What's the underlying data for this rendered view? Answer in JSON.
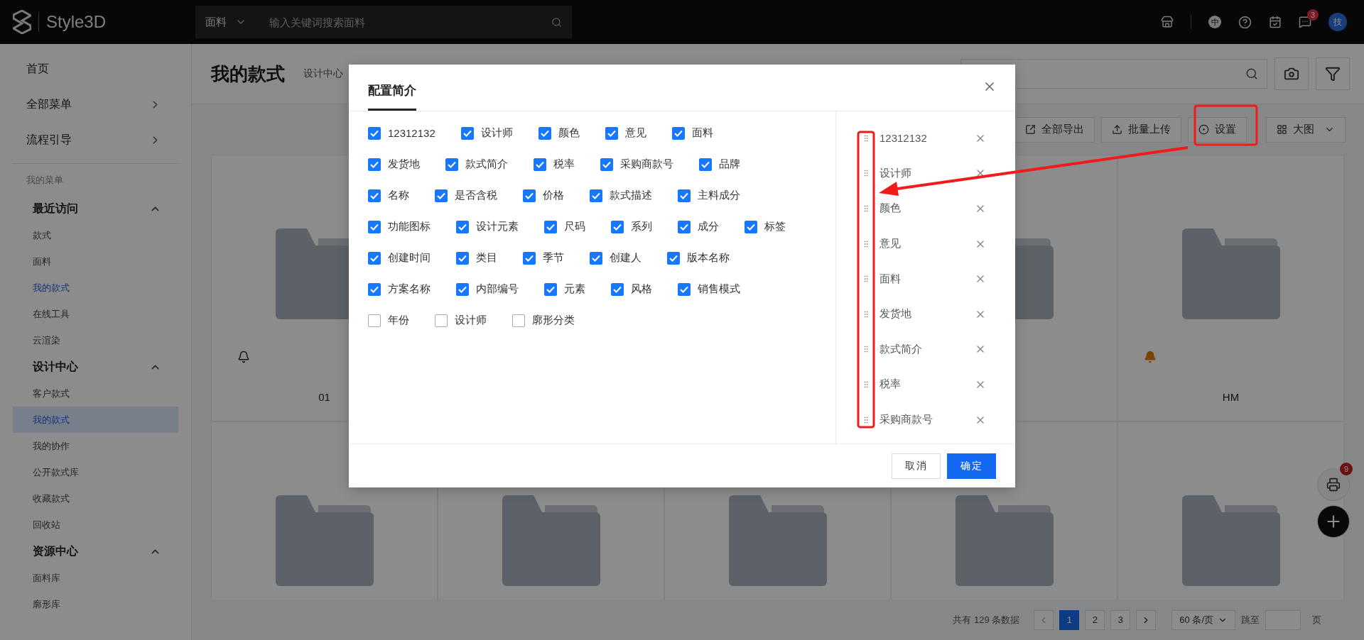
{
  "topbar": {
    "logo_text": "Style3D",
    "search_scope": "面料",
    "search_placeholder": "输入关键词搜索面料",
    "lang_label": "中",
    "message_count": "3",
    "avatar_label": "技"
  },
  "sidebar": {
    "top_items": [
      {
        "label": "首页",
        "has_arrow": false
      },
      {
        "label": "全部菜单",
        "has_arrow": true
      },
      {
        "label": "流程引导",
        "has_arrow": true
      }
    ],
    "section_label": "我的菜单",
    "groups": [
      {
        "title": "最近访问",
        "expanded": true,
        "items": [
          {
            "label": "款式",
            "active": false,
            "selected": false
          },
          {
            "label": "面料",
            "active": false,
            "selected": false
          },
          {
            "label": "我的款式",
            "active": true,
            "selected": false
          },
          {
            "label": "在线工具",
            "active": false,
            "selected": false
          },
          {
            "label": "云渲染",
            "active": false,
            "selected": false
          }
        ]
      },
      {
        "title": "设计中心",
        "expanded": true,
        "items": [
          {
            "label": "客户款式",
            "active": false,
            "selected": false
          },
          {
            "label": "我的款式",
            "active": true,
            "selected": true
          },
          {
            "label": "我的协作",
            "active": false,
            "selected": false
          },
          {
            "label": "公开款式库",
            "active": false,
            "selected": false
          },
          {
            "label": "收藏款式",
            "active": false,
            "selected": false
          },
          {
            "label": "回收站",
            "active": false,
            "selected": false
          }
        ]
      },
      {
        "title": "资源中心",
        "expanded": true,
        "items": [
          {
            "label": "面料库",
            "active": false,
            "selected": false
          },
          {
            "label": "廓形库",
            "active": false,
            "selected": false
          }
        ]
      }
    ]
  },
  "page": {
    "title": "我的款式",
    "breadcrumb": "设计中心",
    "toolbar": [
      {
        "label": "全部导出",
        "kind": "export"
      },
      {
        "label": "批量上传",
        "kind": "upload"
      },
      {
        "label": "设置",
        "kind": "settings"
      },
      {
        "label": "大图",
        "kind": "view"
      }
    ],
    "card_rows": [
      [
        {
          "kind": "folder",
          "title": "01",
          "notify": false
        },
        {
          "kind": "folder"
        },
        {
          "kind": "folder",
          "title": "HM",
          "notify": true
        }
      ],
      [
        {
          "kind": "folder"
        },
        {
          "kind": "folder"
        },
        {
          "kind": "folder"
        },
        {
          "kind": "folder"
        },
        {
          "kind": "folder"
        }
      ]
    ],
    "pagination": {
      "total": "共有 129 条数据",
      "pages": [
        {
          "label": "1",
          "selected": true
        },
        {
          "label": "2",
          "selected": false
        },
        {
          "label": "3",
          "selected": false
        }
      ],
      "page_size": "60 条/页",
      "jump_label": "跳至",
      "page_unit": "页"
    },
    "print_count": "9"
  },
  "dialog": {
    "tabs": [
      {
        "label": "配置简介",
        "selected": true
      }
    ],
    "option_rows": [
      [
        {
          "label": "12312132",
          "checked": true
        },
        {
          "label": "设计师",
          "checked": true
        },
        {
          "label": "颜色",
          "checked": true
        },
        {
          "label": "意见",
          "checked": true
        },
        {
          "label": "面料",
          "checked": true
        }
      ],
      [
        {
          "label": "发货地",
          "checked": true
        },
        {
          "label": "款式简介",
          "checked": true
        },
        {
          "label": "税率",
          "checked": true
        },
        {
          "label": "采购商款号",
          "checked": true
        },
        {
          "label": "品牌",
          "checked": true
        }
      ],
      [
        {
          "label": "名称",
          "checked": true
        },
        {
          "label": "是否含税",
          "checked": true
        },
        {
          "label": "价格",
          "checked": true
        },
        {
          "label": "款式描述",
          "checked": true
        },
        {
          "label": "主料成分",
          "checked": true
        }
      ],
      [
        {
          "label": "功能图标",
          "checked": true
        },
        {
          "label": "设计元素",
          "checked": true
        },
        {
          "label": "尺码",
          "checked": true
        },
        {
          "label": "系列",
          "checked": true
        },
        {
          "label": "成分",
          "checked": true
        },
        {
          "label": "标签",
          "checked": true
        }
      ],
      [
        {
          "label": "创建时间",
          "checked": true
        },
        {
          "label": "类目",
          "checked": true
        },
        {
          "label": "季节",
          "checked": true
        },
        {
          "label": "创建人",
          "checked": true
        },
        {
          "label": "版本名称",
          "checked": true
        }
      ],
      [
        {
          "label": "方案名称",
          "checked": true
        },
        {
          "label": "内部编号",
          "checked": true
        },
        {
          "label": "元素",
          "checked": true
        },
        {
          "label": "风格",
          "checked": true
        },
        {
          "label": "销售模式",
          "checked": true
        }
      ],
      [
        {
          "label": "年份",
          "checked": false
        },
        {
          "label": "设计师",
          "checked": false
        },
        {
          "label": "廓形分类",
          "checked": false
        }
      ]
    ],
    "order_list": [
      "12312132",
      "设计师",
      "颜色",
      "意见",
      "面料",
      "发货地",
      "款式简介",
      "税率",
      "采购商款号"
    ],
    "buttons": [
      {
        "label": "取消",
        "kind": "secondary"
      },
      {
        "label": "确定",
        "kind": "primary"
      }
    ]
  }
}
